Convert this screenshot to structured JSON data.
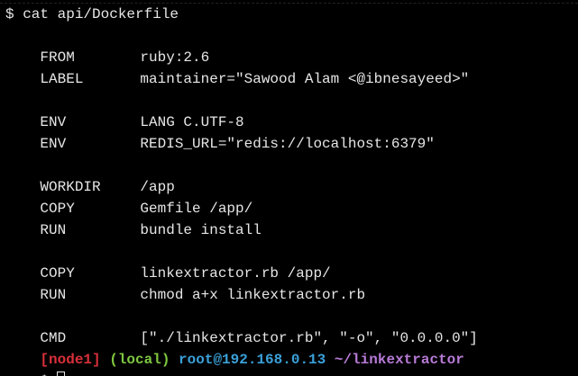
{
  "terminal": {
    "command_line": "$ cat api/Dockerfile",
    "dockerfile": [
      {
        "kw": "FROM",
        "arg": "ruby:2.6"
      },
      {
        "kw": "LABEL",
        "arg": "maintainer=\"Sawood Alam <@ibnesayeed>\""
      },
      {
        "kw": "ENV",
        "arg": "LANG C.UTF-8"
      },
      {
        "kw": "ENV",
        "arg": "REDIS_URL=\"redis://localhost:6379\""
      },
      {
        "kw": "WORKDIR",
        "arg": "/app"
      },
      {
        "kw": "COPY",
        "arg": "Gemfile /app/"
      },
      {
        "kw": "RUN",
        "arg": "bundle install"
      },
      {
        "kw": "COPY",
        "arg": "linkextractor.rb /app/"
      },
      {
        "kw": "RUN",
        "arg": "chmod a+x linkextractor.rb"
      },
      {
        "kw": "CMD",
        "arg": "[\"./linkextractor.rb\", \"-o\", \"0.0.0.0\"]"
      }
    ],
    "prompt": {
      "node": "[node1]",
      "env": "(local)",
      "user_host": "root@192.168.0.13",
      "path": "~/linkextractor",
      "symbol": "$"
    }
  },
  "colors": {
    "background": "#000000",
    "text": "#e6e6e6",
    "node": "#d9303a",
    "local": "#7ec640",
    "user_host": "#3aa0d8",
    "path": "#b77ad6"
  }
}
